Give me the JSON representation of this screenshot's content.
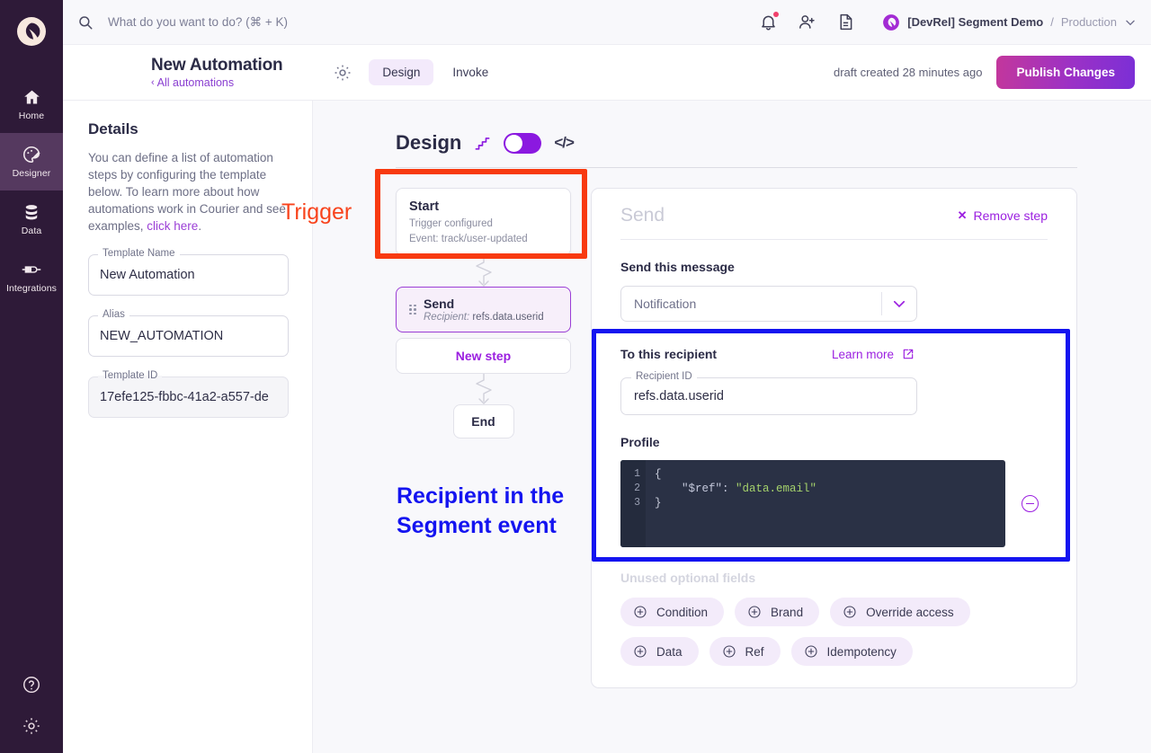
{
  "rail": {
    "logo_name": "courier-logo",
    "items": [
      {
        "label": "Home",
        "icon": "home-icon",
        "active": false
      },
      {
        "label": "Designer",
        "icon": "palette-icon",
        "active": true
      },
      {
        "label": "Data",
        "icon": "database-icon",
        "active": false
      },
      {
        "label": "Integrations",
        "icon": "plug-icon",
        "active": false
      }
    ],
    "bottom": [
      {
        "icon": "help-circle-icon"
      },
      {
        "icon": "gear-icon"
      }
    ]
  },
  "topbar": {
    "search_placeholder": "What do you want to do? (⌘ + K)",
    "search_value": "",
    "icons": [
      "bell-icon",
      "add-user-icon",
      "document-icon"
    ],
    "workspace": {
      "name": "[DevRel] Segment Demo",
      "separator": "/",
      "environment": "Production"
    }
  },
  "pagehead": {
    "title": "New Automation",
    "back_link": "All automations",
    "back_chevron": "‹",
    "gear": "gear-icon",
    "tabs": [
      {
        "label": "Design",
        "active": true
      },
      {
        "label": "Invoke",
        "active": false
      }
    ],
    "draft_status": "draft created 28 minutes ago",
    "publish_label": "Publish Changes"
  },
  "details": {
    "heading": "Details",
    "description_before": "You can define a list of automation steps by configuring the template below. To learn more about how automations work in Courier and see examples, ",
    "description_link": "click here",
    "description_after": ".",
    "fields": [
      {
        "label": "Template Name",
        "value": "New Automation",
        "disabled": false
      },
      {
        "label": "Alias",
        "value": "NEW_AUTOMATION",
        "disabled": false
      },
      {
        "label": "Template ID",
        "value": "17efe125-fbbc-41a2-a557-de",
        "disabled": true
      }
    ]
  },
  "design": {
    "title": "Design",
    "toggle_on": true,
    "stairs_icon": "workflow-steps-icon",
    "code_icon": "</>"
  },
  "flow": {
    "start": {
      "title": "Start",
      "sub1": "Trigger configured",
      "sub2": "Event: track/user-updated"
    },
    "send": {
      "title": "Send",
      "sub_label": "Recipient:",
      "sub_value": "refs.data.userid"
    },
    "new_step": "New step",
    "end": "End"
  },
  "send_config": {
    "card_title": "Send",
    "remove_step": "Remove step",
    "remove_x": "✕",
    "message_label": "Send this message",
    "message_value": "Notification",
    "recipient_heading": "To this recipient",
    "learn_more": "Learn more",
    "recipient_field_label": "Recipient ID",
    "recipient_field_value": "refs.data.userid",
    "profile_label": "Profile",
    "profile_code": {
      "lines": [
        "1",
        "2",
        "3"
      ],
      "line1": "{",
      "key": "\"$ref\"",
      "colon": ": ",
      "value": "\"data.email\"",
      "line3": "}"
    },
    "unused_label": "Unused optional fields",
    "chips": [
      {
        "label": "Condition"
      },
      {
        "label": "Brand"
      },
      {
        "label": "Override access"
      },
      {
        "label": "Data"
      },
      {
        "label": "Ref"
      },
      {
        "label": "Idempotency"
      }
    ]
  },
  "annotations": [
    {
      "text": "Trigger",
      "color": "#F8431C"
    },
    {
      "text": "Recipient in the Segment event",
      "color": "#1414F0"
    }
  ],
  "colors": {
    "rail_bg": "#2E1A38",
    "accent_purple": "#9B1FE0",
    "anno_red": "#F83A10",
    "anno_blue": "#1414F0"
  }
}
